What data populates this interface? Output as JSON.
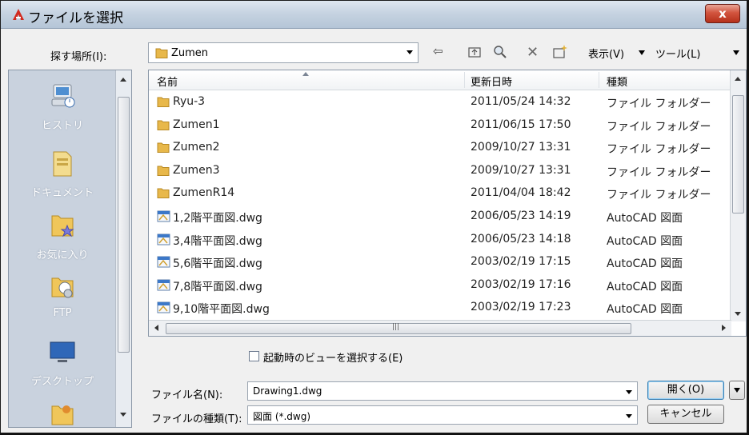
{
  "window": {
    "title": "ファイルを選択",
    "close_label": "x"
  },
  "toolbar": {
    "lookin_label": "探す場所(I):",
    "lookin_value": "Zumen",
    "view_label": "表示(V)",
    "tools_label": "ツール(L)"
  },
  "places": [
    {
      "label": "ヒストリ",
      "icon": "history-icon"
    },
    {
      "label": "ドキュメント",
      "icon": "documents-icon"
    },
    {
      "label": "お気に入り",
      "icon": "favorites-icon"
    },
    {
      "label": "FTP",
      "icon": "ftp-icon"
    },
    {
      "label": "デスクトップ",
      "icon": "desktop-icon"
    },
    {
      "label": "",
      "icon": "buzzsaw-icon"
    }
  ],
  "list": {
    "columns": {
      "name": "名前",
      "date": "更新日時",
      "type": "種類"
    },
    "rows": [
      {
        "name": "Ryu-3",
        "date": "2011/05/24 14:32",
        "type": "ファイル フォルダー",
        "kind": "folder"
      },
      {
        "name": "Zumen1",
        "date": "2011/06/15 17:50",
        "type": "ファイル フォルダー",
        "kind": "folder"
      },
      {
        "name": "Zumen2",
        "date": "2009/10/27 13:31",
        "type": "ファイル フォルダー",
        "kind": "folder"
      },
      {
        "name": "Zumen3",
        "date": "2009/10/27 13:31",
        "type": "ファイル フォルダー",
        "kind": "folder"
      },
      {
        "name": "ZumenR14",
        "date": "2011/04/04 18:42",
        "type": "ファイル フォルダー",
        "kind": "folder"
      },
      {
        "name": "1,2階平面図.dwg",
        "date": "2006/05/23 14:19",
        "type": "AutoCAD 図面",
        "kind": "dwg"
      },
      {
        "name": "3,4階平面図.dwg",
        "date": "2006/05/23 14:18",
        "type": "AutoCAD 図面",
        "kind": "dwg"
      },
      {
        "name": "5,6階平面図.dwg",
        "date": "2003/02/19 17:15",
        "type": "AutoCAD 図面",
        "kind": "dwg"
      },
      {
        "name": "7,8階平面図.dwg",
        "date": "2003/02/19 17:16",
        "type": "AutoCAD 図面",
        "kind": "dwg"
      },
      {
        "name": "9,10階平面図.dwg",
        "date": "2003/02/19 17:23",
        "type": "AutoCAD 図面",
        "kind": "dwg"
      }
    ]
  },
  "options": {
    "select_view_label": "起動時のビューを選択する(E)"
  },
  "filename": {
    "label": "ファイル名(N):",
    "value": "Drawing1.dwg"
  },
  "filetype": {
    "label": "ファイルの種類(T):",
    "value": "図面 (*.dwg)"
  },
  "buttons": {
    "open": "開く(O)",
    "cancel": "キャンセル"
  },
  "colors": {
    "folder": "#e8b84a",
    "accent": "#3c7fb1",
    "close": "#c8432c"
  }
}
